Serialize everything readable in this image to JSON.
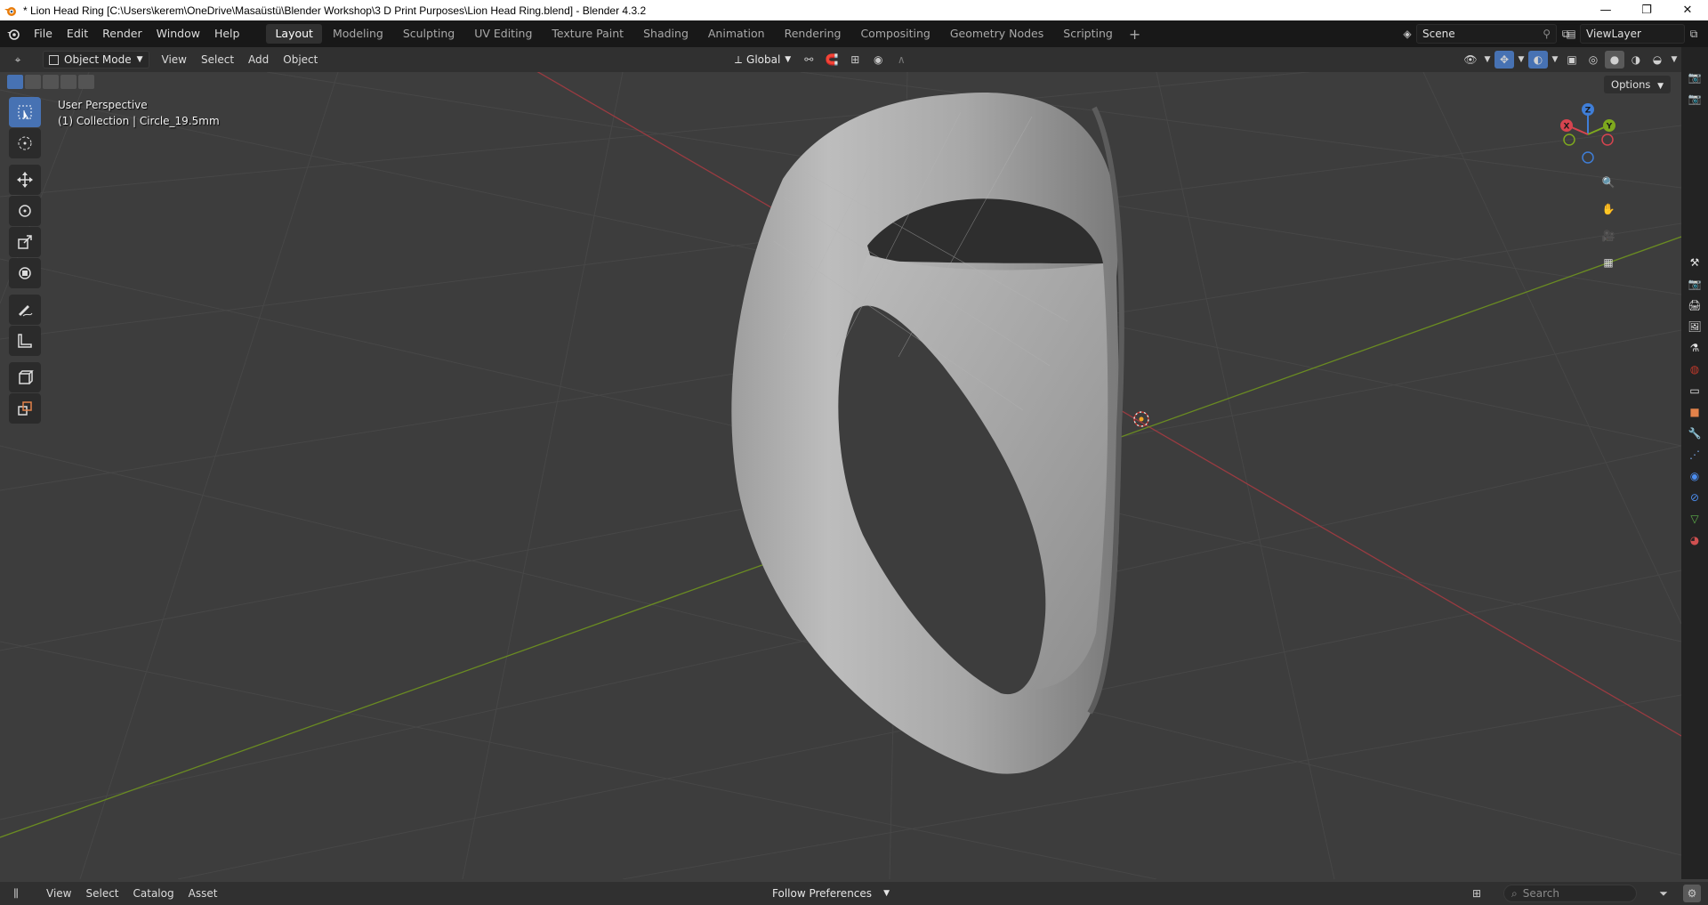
{
  "window": {
    "title": "* Lion Head Ring [C:\\Users\\kerem\\OneDrive\\Masaüstü\\Blender Workshop\\3 D Print Purposes\\Lion Head Ring.blend] - Blender 4.3.2"
  },
  "menus": [
    "File",
    "Edit",
    "Render",
    "Window",
    "Help"
  ],
  "workspaces": [
    "Layout",
    "Modeling",
    "Sculpting",
    "UV Editing",
    "Texture Paint",
    "Shading",
    "Animation",
    "Rendering",
    "Compositing",
    "Geometry Nodes",
    "Scripting"
  ],
  "active_workspace": "Layout",
  "scene": {
    "name": "Scene"
  },
  "view_layer": {
    "name": "ViewLayer"
  },
  "viewport_header": {
    "mode": "Object Mode",
    "menus": [
      "View",
      "Select",
      "Add",
      "Object"
    ],
    "orientation": "Global"
  },
  "viewport": {
    "perspective_label": "User Perspective",
    "collection_label": "(1) Collection | Circle_19.5mm",
    "options_label": "Options",
    "gizmo_axes": {
      "x": "X",
      "y": "Y",
      "z": "Z"
    }
  },
  "bottom_bar": {
    "menus": [
      "View",
      "Select",
      "Catalog",
      "Asset"
    ],
    "follow": "Follow Preferences",
    "search_placeholder": "Search"
  },
  "colors": {
    "accent": "#4772b3",
    "x_axis": "#d6444f",
    "y_axis": "#7ea81e",
    "z_axis": "#3f7ed8"
  }
}
